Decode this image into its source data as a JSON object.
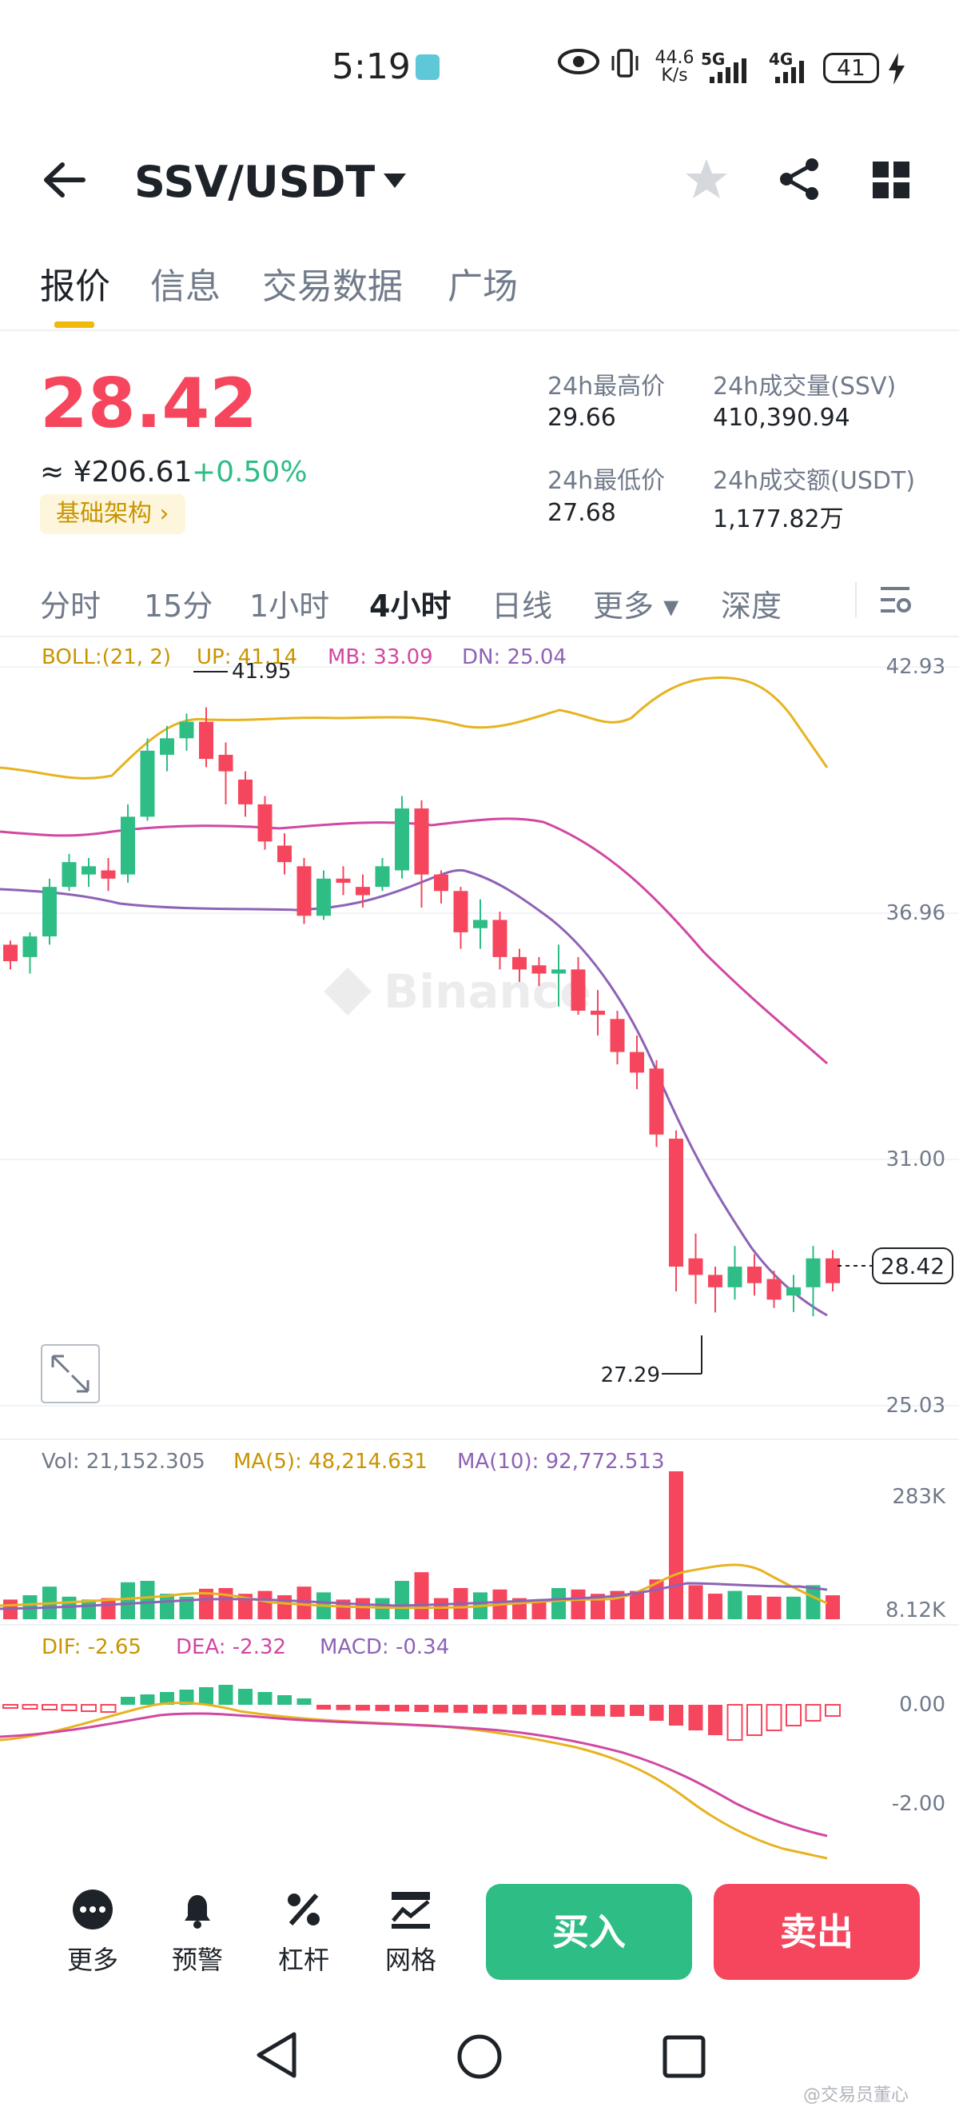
{
  "status_bar": {
    "time": "5:19",
    "net_speed": "44.6 K/s",
    "network_1": "5G",
    "network_2": "4G",
    "battery": "41"
  },
  "header": {
    "title": "SSV/USDT"
  },
  "tabs": [
    {
      "label": "报价",
      "active": true
    },
    {
      "label": "信息",
      "active": false
    },
    {
      "label": "交易数据",
      "active": false
    },
    {
      "label": "广场",
      "active": false
    }
  ],
  "price": {
    "last": "28.42",
    "approx_cny": "≈ ¥206.61",
    "change_pct": "+0.50%",
    "tag": "基础架构 ›"
  },
  "stats": {
    "high_label": "24h最高价",
    "high_value": "29.66",
    "low_label": "24h最低价",
    "low_value": "27.68",
    "vol_base_label": "24h成交量(SSV)",
    "vol_base_value": "410,390.94",
    "vol_quote_label": "24h成交额(USDT)",
    "vol_quote_value": "1,177.82万"
  },
  "intervals": [
    {
      "label": "分时",
      "active": false
    },
    {
      "label": "15分",
      "active": false
    },
    {
      "label": "1小时",
      "active": false
    },
    {
      "label": "4小时",
      "active": true
    },
    {
      "label": "日线",
      "active": false
    },
    {
      "label": "更多 ▾",
      "active": false
    },
    {
      "label": "深度",
      "active": false
    }
  ],
  "chart_data": {
    "type": "candlestick",
    "boll": {
      "label": "BOLL:(21, 2)",
      "up": "UP: 41.14",
      "mb": "MB: 33.09",
      "dn": "DN: 25.04"
    },
    "price_axis": [
      "42.93",
      "36.96",
      "31.00",
      "25.03"
    ],
    "ylim": [
      25.03,
      42.93
    ],
    "current_price_label": "28.42",
    "current_price": 28.42,
    "max_label": "41.95",
    "min_label": "27.29",
    "candles": [
      [
        36.2,
        35.8,
        36.3,
        35.6
      ],
      [
        35.9,
        36.4,
        36.5,
        35.5
      ],
      [
        36.4,
        37.6,
        37.8,
        36.2
      ],
      [
        37.6,
        38.2,
        38.4,
        37.5
      ],
      [
        37.9,
        38.1,
        38.3,
        37.6
      ],
      [
        38.0,
        37.8,
        38.3,
        37.5
      ],
      [
        37.9,
        39.3,
        39.6,
        37.7
      ],
      [
        39.3,
        40.9,
        41.2,
        39.2
      ],
      [
        40.8,
        41.2,
        41.5,
        40.4
      ],
      [
        41.2,
        41.6,
        41.8,
        40.9
      ],
      [
        41.6,
        40.7,
        41.95,
        40.5
      ],
      [
        40.8,
        40.4,
        41.1,
        39.6
      ],
      [
        40.2,
        39.6,
        40.4,
        39.3
      ],
      [
        39.6,
        38.7,
        39.8,
        38.5
      ],
      [
        38.6,
        38.2,
        38.9,
        37.9
      ],
      [
        38.1,
        36.9,
        38.3,
        36.7
      ],
      [
        36.9,
        37.8,
        38.0,
        36.8
      ],
      [
        37.8,
        37.7,
        38.1,
        37.4
      ],
      [
        37.6,
        37.4,
        37.9,
        37.1
      ],
      [
        37.6,
        38.1,
        38.3,
        37.5
      ],
      [
        38.0,
        39.5,
        39.8,
        37.8
      ],
      [
        39.5,
        37.9,
        39.7,
        37.1
      ],
      [
        37.9,
        37.5,
        38.0,
        37.2
      ],
      [
        37.5,
        36.5,
        37.6,
        36.1
      ],
      [
        36.6,
        36.8,
        37.3,
        36.1
      ],
      [
        36.8,
        35.9,
        37.0,
        35.6
      ],
      [
        35.9,
        35.6,
        36.1,
        35.3
      ],
      [
        35.7,
        35.5,
        35.9,
        35.2
      ],
      [
        35.5,
        35.6,
        36.2,
        34.7
      ],
      [
        35.6,
        34.6,
        35.9,
        34.5
      ],
      [
        34.6,
        34.5,
        35.1,
        34.0
      ],
      [
        34.4,
        33.6,
        34.6,
        33.3
      ],
      [
        33.6,
        33.1,
        34.0,
        32.7
      ],
      [
        33.2,
        31.6,
        33.4,
        31.3
      ],
      [
        31.5,
        28.4,
        31.7,
        27.8
      ],
      [
        28.6,
        28.2,
        29.2,
        27.5
      ],
      [
        28.2,
        27.9,
        28.4,
        27.29
      ],
      [
        27.9,
        28.4,
        28.9,
        27.6
      ],
      [
        28.4,
        28.0,
        28.7,
        27.7
      ],
      [
        28.1,
        27.6,
        28.3,
        27.4
      ],
      [
        27.7,
        27.9,
        28.2,
        27.3
      ],
      [
        27.9,
        28.6,
        28.9,
        27.2
      ],
      [
        28.6,
        28.0,
        28.8,
        27.8
      ]
    ],
    "volume": {
      "label": "Vol: 21,152.305",
      "ma5": "MA(5): 48,214.631",
      "ma10": "MA(10): 92,772.513",
      "axis": [
        "283K",
        "8.12K"
      ]
    },
    "macd": {
      "dif": "DIF: -2.65",
      "dea": "DEA: -2.32",
      "macd": "MACD: -0.34",
      "axis": [
        "0.00",
        "-2.00"
      ]
    }
  },
  "watermark": "Binance",
  "bottom_bar": {
    "more": "更多",
    "alert": "预警",
    "leverage": "杠杆",
    "grid": "网格",
    "buy": "买入",
    "sell": "卖出"
  },
  "credit": "@交易员董心",
  "colors": {
    "up": "#2ebd85",
    "down": "#f6465d",
    "accent": "#f0b90b",
    "mb_line": "#d147a3",
    "dn_line": "#8e62b6"
  }
}
